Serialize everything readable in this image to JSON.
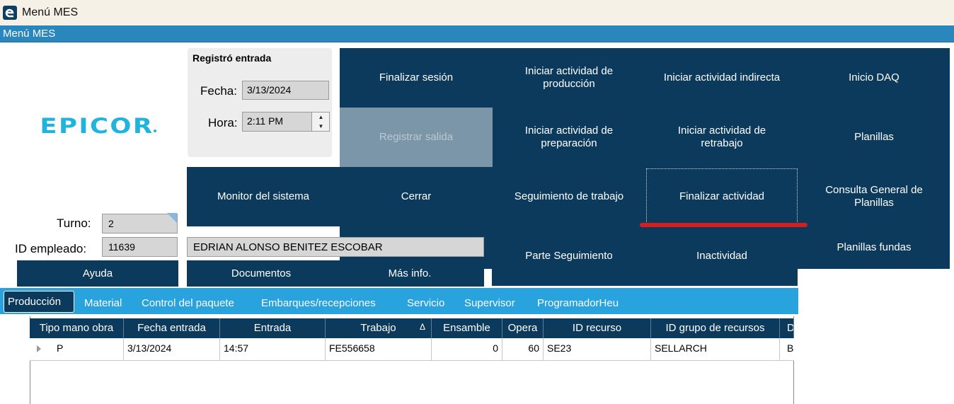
{
  "window": {
    "title": "Menú MES"
  },
  "header": {
    "title": "Menú MES"
  },
  "logo": {
    "text": "EPICOR"
  },
  "clock": {
    "title": "Registró entrada",
    "fecha_label": "Fecha:",
    "fecha_value": "3/13/2024",
    "hora_label": "Hora:",
    "hora_value": "2:11 PM"
  },
  "buttons": {
    "finalizar_sesion": "Finalizar sesión",
    "iniciar_produccion": "Iniciar actividad de producción",
    "iniciar_indirecta": "Iniciar actividad indirecta",
    "inicio_daq": "Inicio DAQ",
    "registrar_salida": "Registrar salida",
    "iniciar_preparacion": "Iniciar actividad de preparación",
    "iniciar_retrabajo": "Iniciar actividad de retrabajo",
    "planillas": "Planillas",
    "monitor_sistema": "Monitor del sistema",
    "cerrar": "Cerrar",
    "seguimiento_trabajo": "Seguimiento de trabajo",
    "finalizar_actividad": "Finalizar actividad",
    "consulta_planillas": "Consulta General de Planillas",
    "parte_seguimiento": "Parte Seguimiento",
    "inactividad": "Inactividad",
    "planillas_fundas": "Planillas fundas",
    "ayuda": "Ayuda",
    "documentos": "Documentos",
    "mas_info": "Más info."
  },
  "employee": {
    "turno_label": "Turno:",
    "turno_value": "2",
    "id_label": "ID empleado:",
    "id_value": "11639",
    "name": "EDRIAN ALONSO BENITEZ ESCOBAR"
  },
  "tabs": [
    "Producción",
    "Material",
    "Control del paquete",
    "Embarques/recepciones",
    "Servicio",
    "Supervisor",
    "ProgramadorHeu"
  ],
  "table": {
    "columns": [
      "Tipo mano obra",
      "Fecha entrada",
      "Entrada",
      "Trabajo",
      "Ensamble",
      "Opera",
      "ID recurso",
      "ID grupo de recursos",
      "D"
    ],
    "sort_indicator": "Δ",
    "rows": [
      [
        "P",
        "3/13/2024",
        "14:57",
        "FE556658",
        "0",
        "60",
        "SE23",
        "SELLARCH",
        "B"
      ]
    ]
  },
  "colors": {
    "navy": "#0c3a5c",
    "header_band": "#2a87be",
    "tab_strip": "#29a3dd",
    "logo": "#1fb3de",
    "highlight_red": "#d61e1e"
  }
}
